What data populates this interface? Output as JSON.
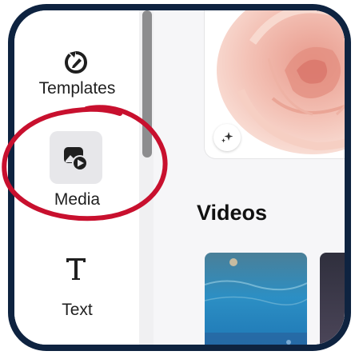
{
  "sidebar": {
    "items": [
      {
        "label": "Templates",
        "icon": "templates-icon",
        "active": false
      },
      {
        "label": "Media",
        "icon": "media-icon",
        "active": true
      },
      {
        "label": "Text",
        "icon": "text-icon",
        "active": false
      }
    ]
  },
  "main": {
    "section_title": "Videos"
  },
  "colors": {
    "frame": "#0e2340",
    "annotation": "#c8102e",
    "active_bg": "#e7e7ea",
    "scroll_thumb": "#8d8d8f"
  }
}
